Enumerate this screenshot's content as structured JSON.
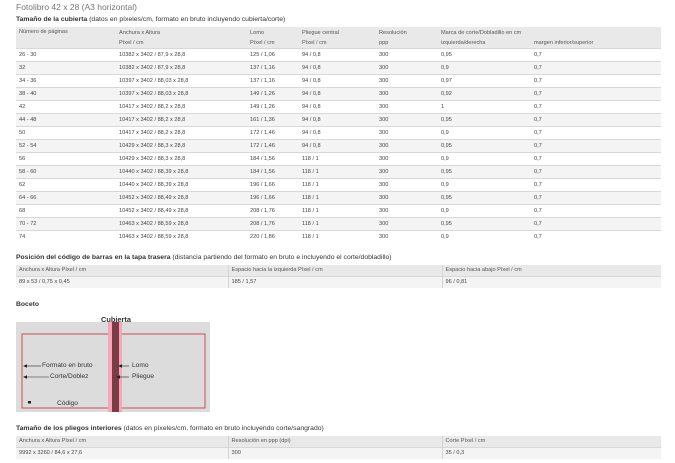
{
  "page_title": "Fotolibro 42 x 28 (A3 horizontal)",
  "cover": {
    "title_bold": "Tamaño de la cubierta",
    "title_rest": " (datos en píxeles/cm, formato en bruto incluyendo cubierta/corte)",
    "headers": {
      "pages": "Número de páginas",
      "size": "Anchura x Altura",
      "size_sub": "Píxel / cm",
      "spine": "Lomo",
      "spine_sub": "Píxel / cm",
      "fold": "Pliegue central",
      "fold_sub": "Píxel / cm",
      "res": "Resolución",
      "res_sub": "ppp",
      "mark": "Marca de corte/Dobladillo en cm",
      "lr": "izquierda/derecha",
      "tb": "margen inferior/superior"
    },
    "rows": [
      [
        "26 - 30",
        "10382 x 3402 / 87,9 x 28,8",
        "125 / 1,06",
        "94 / 0,8",
        "300",
        "0,95",
        "0,7"
      ],
      [
        "32",
        "10382 x 3402 / 87,9 x 28,8",
        "137 / 1,16",
        "94 / 0,8",
        "300",
        "0,9",
        "0,7"
      ],
      [
        "34 - 36",
        "10397 x 3402 / 88,03 x 28,8",
        "137 / 1,16",
        "94 / 0,8",
        "300",
        "0,97",
        "0,7"
      ],
      [
        "38 - 40",
        "10397 x 3402 / 88,03 x 28,8",
        "149 / 1,26",
        "94 / 0,8",
        "300",
        "0,92",
        "0,7"
      ],
      [
        "42",
        "10417 x 3402 / 88,2 x 28,8",
        "149 / 1,26",
        "94 / 0,8",
        "300",
        "1",
        "0,7"
      ],
      [
        "44 - 48",
        "10417 x 3402 / 88,2 x 28,8",
        "161 / 1,36",
        "94 / 0,8",
        "300",
        "0,95",
        "0,7"
      ],
      [
        "50",
        "10417 x 3402 / 88,2 x 28,8",
        "172 / 1,46",
        "94 / 0,8",
        "300",
        "0,9",
        "0,7"
      ],
      [
        "52 - 54",
        "10429 x 3402 / 88,3 x 28,8",
        "172 / 1,46",
        "94 / 0,8",
        "300",
        "0,95",
        "0,7"
      ],
      [
        "56",
        "10429 x 3402 / 88,3 x 28,8",
        "184 / 1,56",
        "118 / 1",
        "300",
        "0,9",
        "0,7"
      ],
      [
        "58 - 60",
        "10440 x 3402 / 88,39 x 28,8",
        "184 / 1,56",
        "118 / 1",
        "300",
        "0,95",
        "0,7"
      ],
      [
        "62",
        "10440 x 3402 / 88,39 x 28,8",
        "196 / 1,66",
        "118 / 1",
        "300",
        "0,9",
        "0,7"
      ],
      [
        "64 - 66",
        "10452 x 3402 / 88,49 x 28,8",
        "196 / 1,66",
        "118 / 1",
        "300",
        "0,95",
        "0,7"
      ],
      [
        "68",
        "10452 x 3402 / 88,49 x 28,8",
        "208 / 1,76",
        "118 / 1",
        "300",
        "0,9",
        "0,7"
      ],
      [
        "70 - 72",
        "10463 x 3402 / 88,59 x 28,8",
        "208 / 1,76",
        "118 / 1",
        "300",
        "0,95",
        "0,7"
      ],
      [
        "74",
        "10463 x 3402 / 88,59 x 28,8",
        "220 / 1,86",
        "118 / 1",
        "300",
        "0,9",
        "0,7"
      ]
    ]
  },
  "barcode": {
    "title_bold": "Posición del código de barras en la tapa trasera",
    "title_rest": " (distancia partiendo del formato en bruto e incluyendo el corte/dobladillo)",
    "headers": [
      "Anchura x Altura Píxel / cm",
      "Espacio hacia la izquierda Píxel / cm",
      "Espacio hacia abajo Píxel / cm"
    ],
    "values": [
      "89 x 53 / 0,75 x 0,45",
      "185 / 1,57",
      "96 / 0,81"
    ]
  },
  "sketch": {
    "title": "Boceto",
    "cover_label": "Cubierta",
    "labels": {
      "raw": "Formato en bruto",
      "cut": "Corte/Doblez",
      "code": "Código",
      "spine": "Lomo",
      "fold": "Pliegue"
    },
    "colors": {
      "frame": "#cc2a36",
      "panel": "#dcdcdc",
      "spine_dark": "#7a3b44",
      "spine_pink": "#f4a7b9"
    }
  },
  "inner": {
    "title_bold": "Tamaño de los pliegos interiores",
    "title_rest": " (datos en píxeles/cm, formato en bruto incluyendo corte/sangrado)",
    "headers": [
      "Anchura x Altura Píxel / cm",
      "Resolución en ppp (dpi)",
      "Corte Píxel / cm"
    ],
    "values": [
      "9992 x 3260 / 84,6 x 27,6",
      "300",
      "35 / 0,3"
    ]
  }
}
